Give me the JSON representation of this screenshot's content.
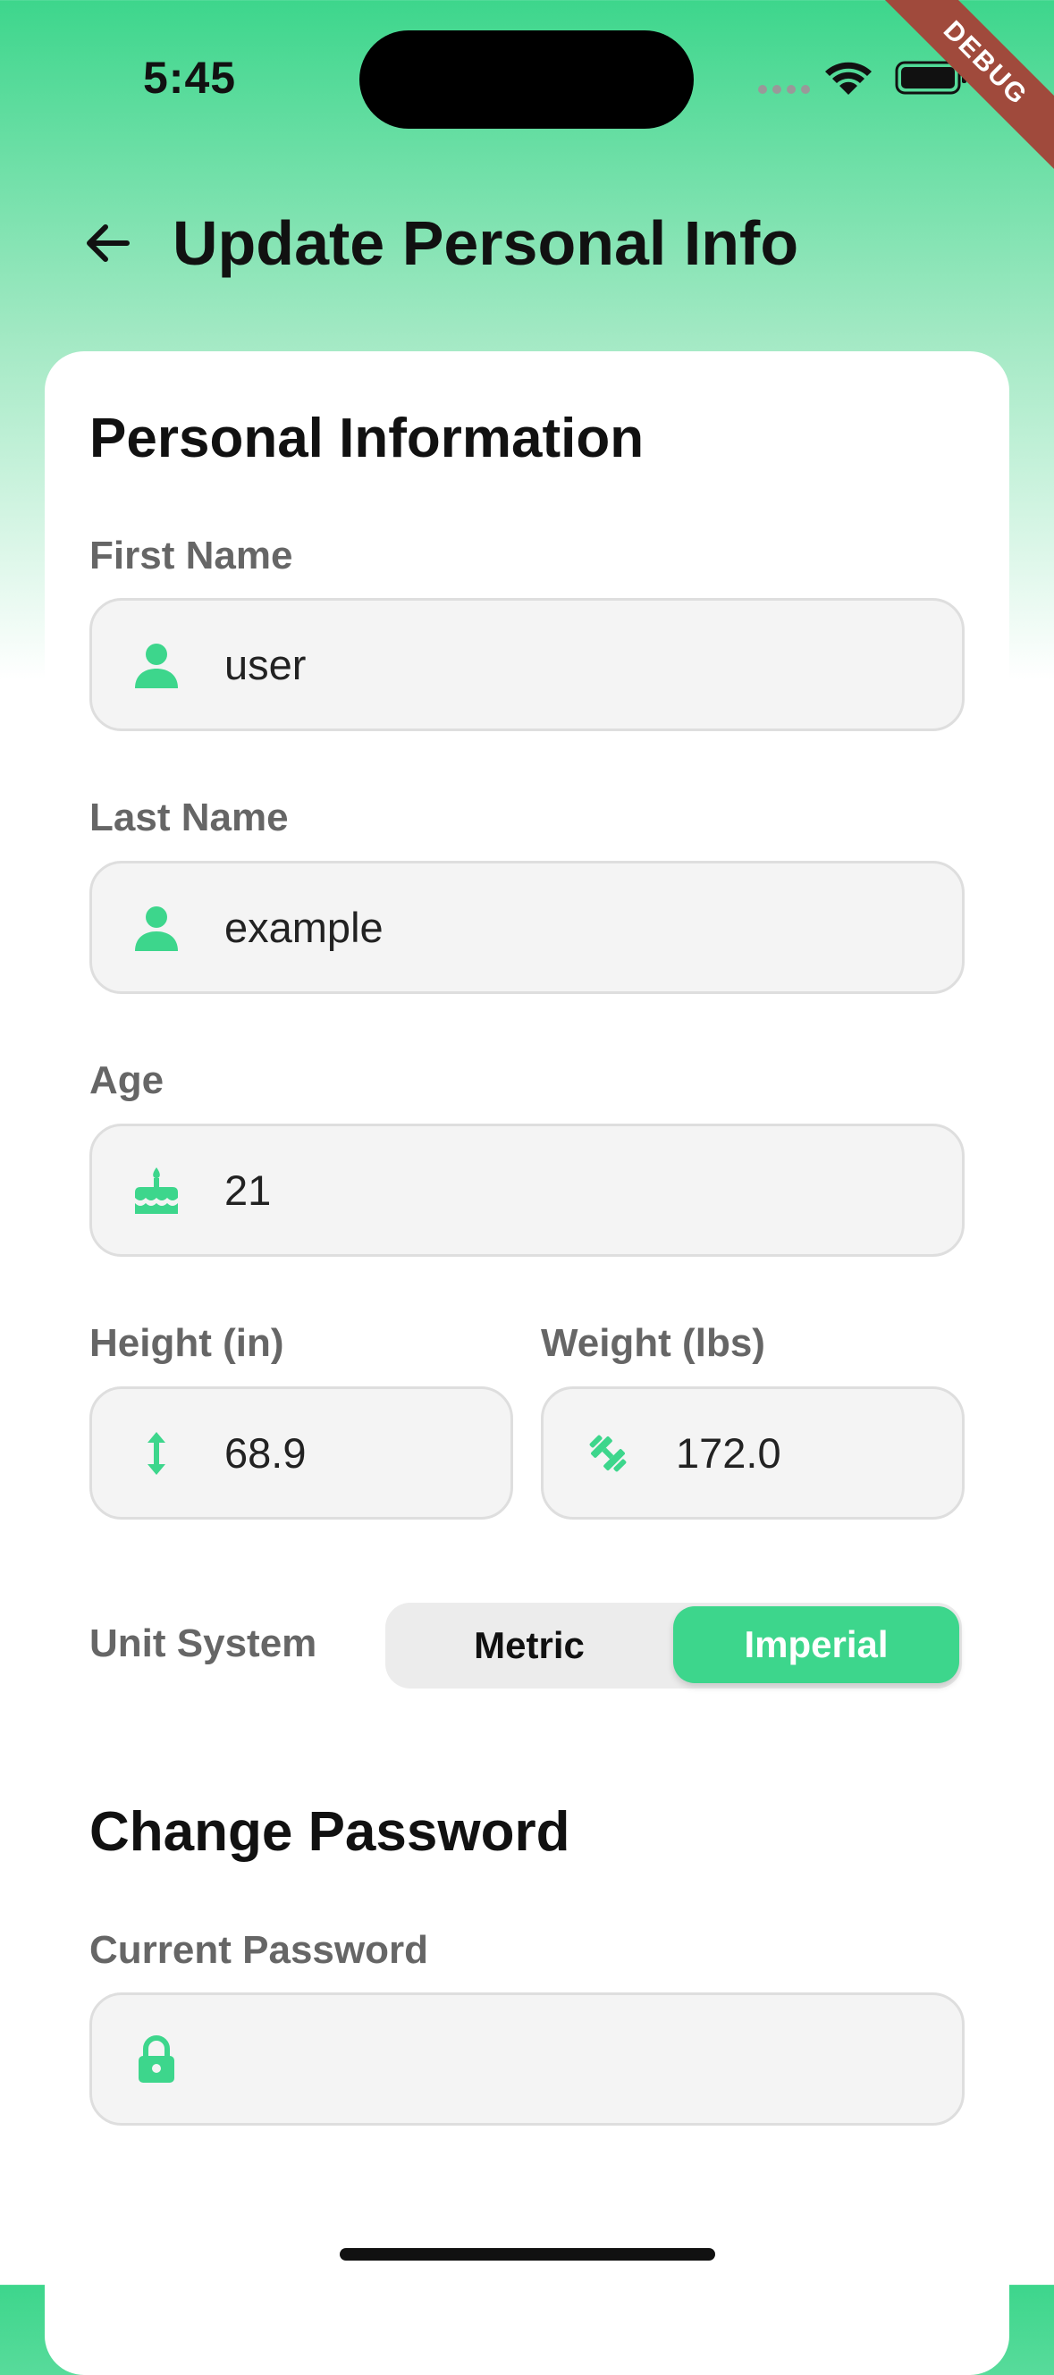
{
  "status_bar": {
    "time": "5:45",
    "debug_banner": "DEBUG"
  },
  "header": {
    "title": "Update Personal Info",
    "back_icon": "arrow-left-icon"
  },
  "personal": {
    "section_title": "Personal Information",
    "first_name": {
      "label": "First Name",
      "value": "user",
      "icon": "person-icon"
    },
    "last_name": {
      "label": "Last Name",
      "value": "example",
      "icon": "person-icon"
    },
    "age": {
      "label": "Age",
      "value": "21",
      "icon": "cake-icon"
    },
    "height": {
      "label": "Height (in)",
      "value": "68.9",
      "icon": "vertical-arrows-icon"
    },
    "weight": {
      "label": "Weight (lbs)",
      "value": "172.0",
      "icon": "dumbbell-icon"
    },
    "unit_system": {
      "label": "Unit System",
      "options": [
        "Metric",
        "Imperial"
      ],
      "selected": "Imperial"
    }
  },
  "password": {
    "section_title": "Change Password",
    "current": {
      "label": "Current Password",
      "value": "",
      "icon": "lock-icon"
    }
  },
  "colors": {
    "accent": "#3dd68c",
    "debug": "#a04a3c",
    "label": "#666666",
    "field_bg": "#f4f4f4"
  }
}
